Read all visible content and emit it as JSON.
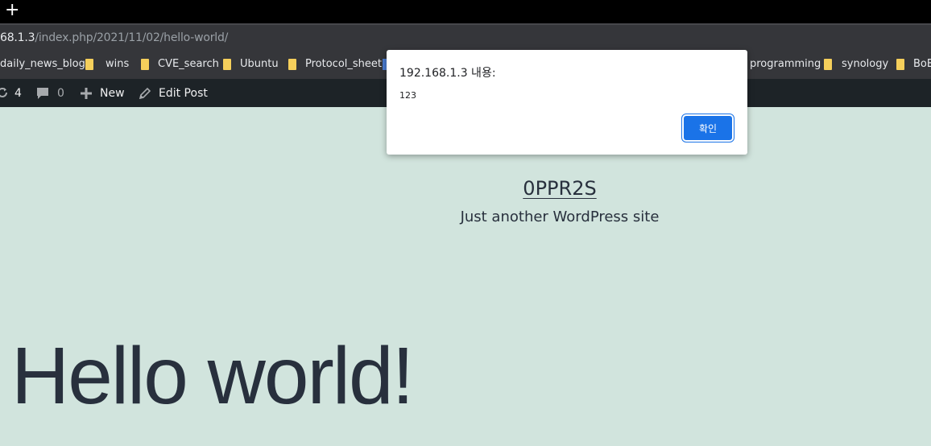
{
  "browser": {
    "new_tab_symbol": "+",
    "url_host": "68.1.3",
    "url_path": "/index.php/2021/11/02/hello-world/"
  },
  "bookmarks": [
    {
      "label": "daily_news_blog",
      "icon": "none"
    },
    {
      "label": "wins",
      "icon": "folder-icon"
    },
    {
      "label": "CVE_search",
      "icon": "folder-icon"
    },
    {
      "label": "Ubuntu",
      "icon": "folder-icon"
    },
    {
      "label": "Protocol_sheet",
      "icon": "folder-icon"
    },
    {
      "label": "programming",
      "icon": "folder-icon"
    },
    {
      "label": "synology",
      "icon": "folder-icon"
    },
    {
      "label": "BoB",
      "icon": "folder-icon"
    }
  ],
  "admin_bar": {
    "updates_count": "4",
    "comments_count": "0",
    "new_label": "New",
    "edit_label": "Edit Post"
  },
  "dialog": {
    "title": "192.168.1.3 내용:",
    "message": "123",
    "ok_label": "확인"
  },
  "site": {
    "title": "0PPR2S",
    "tagline": "Just another WordPress site"
  },
  "post": {
    "title": "Hello world!"
  },
  "colors": {
    "page_background": "#d1e4dd",
    "admin_bar": "#1d2327",
    "browser_chrome": "#35363a",
    "dialog_button": "#1a73e8",
    "folder": "#f5cf5b"
  }
}
